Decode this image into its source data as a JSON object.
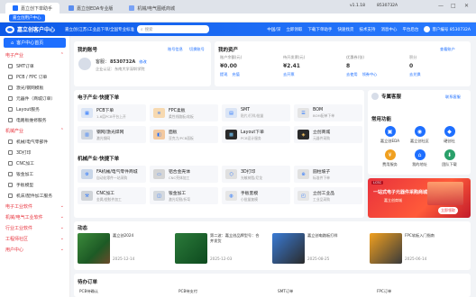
{
  "browser": {
    "tabs": [
      {
        "label": "嘉立创下单助手"
      },
      {
        "label": "嘉立创EDA专业版"
      },
      {
        "label": "机械/电气图纸商城"
      }
    ],
    "sub_tag": "嘉立创用户中心",
    "controls": [
      "—",
      "□",
      "✕"
    ]
  },
  "topbar": {
    "brand": "嘉立创客户中心",
    "region": "嘉立创(江苏)工业品下单/全国专业标准",
    "search_placeholder": "搜索",
    "links": [
      "中国/深",
      "立即领取",
      "下载下单助手",
      "快速找货",
      "技术支持",
      "消息中心",
      "平台后台"
    ],
    "user_label": "客户编号 8530732A",
    "version": "v1.1.18",
    "user_code": "8530732A"
  },
  "sidebar": {
    "home": "客户中心首页",
    "sections": [
      {
        "title": "电子产业",
        "items": [
          "SMT订单",
          "PCB / FPC 订单",
          "激光/钢网模板",
          "元器件（商城订单）",
          "Layout服务",
          "电路板维修服务"
        ]
      },
      {
        "title": "机械产业",
        "items": [
          "机械/电气零部件",
          "3D打印",
          "CNC加工",
          "钣金加工",
          "手板模型",
          "机床/配件加工服务"
        ]
      },
      {
        "title": "电子工业软件"
      },
      {
        "title": "机械/电气工业软件"
      },
      {
        "title": "行业工业软件"
      },
      {
        "title": "工程师社区"
      },
      {
        "title": "用户中心"
      }
    ]
  },
  "account": {
    "title": "我的账号",
    "links": [
      "账号信息",
      "切换账号"
    ],
    "user_prefix": "客服：",
    "user_id": "8530732A",
    "company": "企业认证：东南大学深圳学院",
    "change": "修改"
  },
  "assets": {
    "title": "我的资产",
    "link": "查看账户",
    "items": [
      {
        "label": "账户余额(元)",
        "value": "¥0.00",
        "actions": [
          "提现",
          "充值"
        ]
      },
      {
        "label": "待开发票(元)",
        "value": "¥2.41",
        "actions": [
          "去开票"
        ]
      },
      {
        "label": "优惠券(张)",
        "value": "8",
        "actions": [
          "去使用",
          "领券中心"
        ]
      },
      {
        "label": "积分",
        "value": "0",
        "actions": [
          "去兑换"
        ]
      }
    ]
  },
  "quick_electronics": {
    "title": "电子产业·快捷下单",
    "tiles": [
      {
        "t": "PCB下单",
        "s": "1-6层PCB平台上开"
      },
      {
        "t": "FPC柔板",
        "s": "柔性线路板/软板"
      },
      {
        "t": "SMT",
        "s": "贴片/打样/批量"
      },
      {
        "t": "BOM",
        "s": "BOM配单下单"
      },
      {
        "t": "钢网/激光焊网",
        "s": "激光钢网"
      },
      {
        "t": "面板",
        "s": "亚克力/PCB面板"
      },
      {
        "t": "Layout下单",
        "s": "PCB设计服务"
      },
      {
        "t": "立创商城",
        "s": "元器件采购"
      }
    ]
  },
  "quick_mechanical": {
    "title": "机械产业·快捷下单",
    "tiles": [
      {
        "t": "FA机械/电气零件商城",
        "s": "自动化零件一站采购"
      },
      {
        "t": "铝合金壳体",
        "s": "CNC壳体加工"
      },
      {
        "t": "3D打印",
        "s": "光敏树脂/尼龙"
      },
      {
        "t": "圆柱坡子",
        "s": "标准件下单"
      },
      {
        "t": "CNC加工",
        "s": "金属/塑胶件加工"
      },
      {
        "t": "钣金加工",
        "s": "激光切割/折弯"
      },
      {
        "t": "手板套模",
        "s": "小批量复模"
      },
      {
        "t": "立创工业品",
        "s": "工业品采购"
      }
    ]
  },
  "activities": {
    "title": "动态",
    "items": [
      {
        "text": "嘉立创2024",
        "date": "2025-12-14"
      },
      {
        "text": "第二波：嘉立创品牌型号：合并发货",
        "date": "2025-12-03"
      },
      {
        "text": "嘉立创电路板打样",
        "date": "2025-08-25"
      },
      {
        "text": "FPC软板入门指南",
        "date": "2025-06-14"
      }
    ]
  },
  "pending": {
    "title": "待办订单",
    "columns": [
      "PCB待确认",
      "PCB待支付",
      "SMT订单",
      "FPC订单"
    ]
  },
  "help": {
    "title": "专属客服",
    "link": "联系客服"
  },
  "common": {
    "title": "常用功能",
    "items": [
      {
        "label": "嘉立创EDA",
        "color": "#1e6fff",
        "icon": "▣"
      },
      {
        "label": "嘉立创社区",
        "color": "#1e6fff",
        "icon": "◉"
      },
      {
        "label": "硬创社",
        "color": "#1e6fff",
        "icon": "◆"
      },
      {
        "label": "费用服务",
        "color": "#f0a020",
        "icon": "¥"
      },
      {
        "label": "我的地址",
        "color": "#1e6fff",
        "icon": "⌂"
      },
      {
        "label": "团队下载",
        "color": "#2aa06a",
        "icon": "⬇"
      }
    ]
  },
  "ad": {
    "line1": "一站式电子元器件采购商城",
    "line2": "嘉立创商城",
    "cta": "立即领取",
    "brand": "LCSC"
  }
}
